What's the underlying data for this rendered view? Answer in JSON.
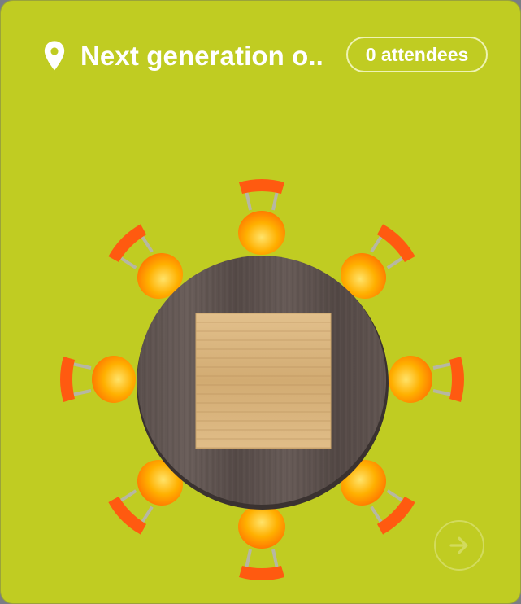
{
  "event": {
    "title": "Next generation o...",
    "attendees_label": "0 attendees"
  },
  "icons": {
    "location": "location-pin-icon",
    "next": "arrow-right-icon"
  },
  "table": {
    "shape": "round",
    "chair_count": 8
  },
  "colors": {
    "card_background": "#c0cc22",
    "chair_seat": "#ffb000",
    "chair_back": "#ff5a10",
    "table_top": "#5e5350",
    "centerpiece": "#d8b47e"
  }
}
